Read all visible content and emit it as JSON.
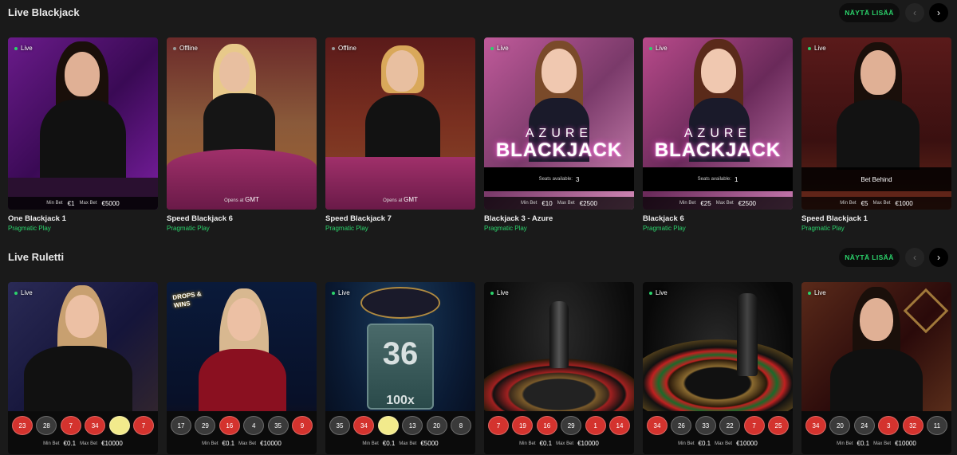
{
  "sections": [
    {
      "title": "Live Blackjack",
      "more_label": "NÄYTÄ LISÄÄ",
      "prev_icon": "‹",
      "next_icon": "›",
      "cards": [
        {
          "name": "One Blackjack 1",
          "provider": "Pragmatic Play",
          "status": "Live",
          "min_label": "Min Bet",
          "min": "€1",
          "max_label": "Max Bet",
          "max": "€5000"
        },
        {
          "name": "Speed Blackjack 6",
          "provider": "Pragmatic Play",
          "status": "Offline",
          "opens_label": "Opens at",
          "opens_value": "GMT"
        },
        {
          "name": "Speed Blackjack 7",
          "provider": "Pragmatic Play",
          "status": "Offline",
          "opens_label": "Opens at",
          "opens_value": "GMT"
        },
        {
          "name": "Blackjack 3 - Azure",
          "provider": "Pragmatic Play",
          "status": "Live",
          "seats_label": "Seats available:",
          "seats": "3",
          "logo_top": "AZURE",
          "logo_bottom": "BLACKJACK",
          "min_label": "Min Bet",
          "min": "€10",
          "max_label": "Max Bet",
          "max": "€2500"
        },
        {
          "name": "Blackjack 6",
          "provider": "Pragmatic Play",
          "status": "Live",
          "seats_label": "Seats available:",
          "seats": "1",
          "logo_top": "AZURE",
          "logo_bottom": "BLACKJACK",
          "min_label": "Min Bet",
          "min": "€25",
          "max_label": "Max Bet",
          "max": "€2500"
        },
        {
          "name": "Speed Blackjack 1",
          "provider": "Pragmatic Play",
          "status": "Live",
          "behind": "Bet Behind",
          "min_label": "Min Bet",
          "min": "€5",
          "max_label": "Max Bet",
          "max": "€1000"
        }
      ]
    },
    {
      "title": "Live Ruletti",
      "more_label": "NÄYTÄ LISÄÄ",
      "prev_icon": "‹",
      "next_icon": "›",
      "cards": [
        {
          "status": "Live",
          "results": [
            "23",
            "28",
            "7",
            "34",
            "",
            "7"
          ],
          "colors": [
            "red",
            "black",
            "red",
            "red",
            "gold",
            "red"
          ],
          "min_label": "Min Bet",
          "min": "€0.1",
          "max_label": "Max Bet",
          "max": "€10000"
        },
        {
          "status": "",
          "badge": "DROPS & WINS",
          "results": [
            "17",
            "29",
            "16",
            "4",
            "35",
            "9"
          ],
          "colors": [
            "black",
            "black",
            "red",
            "black",
            "black",
            "red"
          ],
          "min_label": "Min Bet",
          "min": "€0.1",
          "max_label": "Max Bet",
          "max": "€10000"
        },
        {
          "status": "Live",
          "big_number": "36",
          "multiplier": "100x",
          "results": [
            "35",
            "34",
            "",
            "13",
            "20",
            "8"
          ],
          "colors": [
            "black",
            "red",
            "gold",
            "black",
            "black",
            "black"
          ],
          "min_label": "Min Bet",
          "min": "€0.1",
          "max_label": "Max Bet",
          "max": "€5000"
        },
        {
          "status": "Live",
          "results": [
            "7",
            "19",
            "16",
            "29",
            "1",
            "14"
          ],
          "colors": [
            "red",
            "red",
            "red",
            "black",
            "red",
            "red"
          ],
          "min_label": "Min Bet",
          "min": "€0.1",
          "max_label": "Max Bet",
          "max": "€10000"
        },
        {
          "status": "Live",
          "results": [
            "34",
            "26",
            "33",
            "22",
            "7",
            "25"
          ],
          "colors": [
            "red",
            "black",
            "black",
            "black",
            "red",
            "red"
          ],
          "min_label": "Min Bet",
          "min": "€0.1",
          "max_label": "Max Bet",
          "max": "€10000"
        },
        {
          "status": "Live",
          "results": [
            "34",
            "20",
            "24",
            "3",
            "32",
            "11"
          ],
          "colors": [
            "red",
            "black",
            "black",
            "red",
            "red",
            "black"
          ],
          "min_label": "Min Bet",
          "min": "€0.1",
          "max_label": "Max Bet",
          "max": "€10000"
        }
      ]
    }
  ]
}
